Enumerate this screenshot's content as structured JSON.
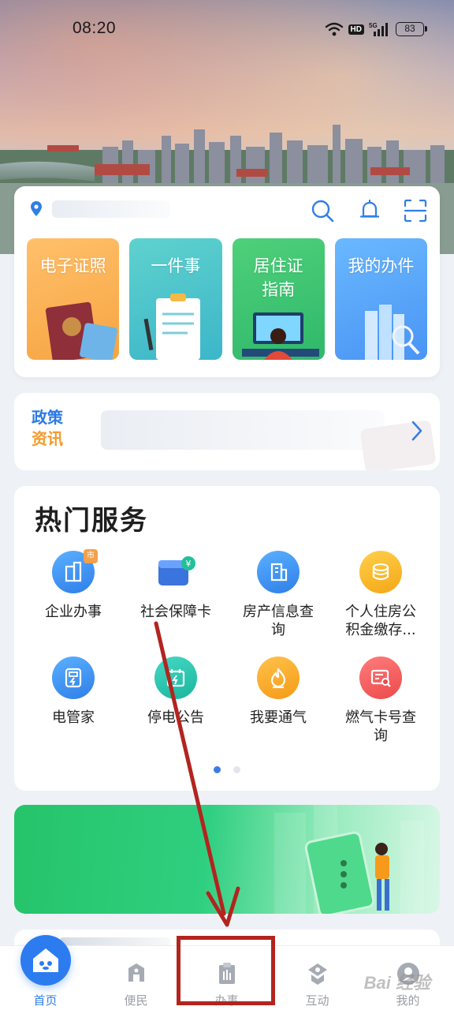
{
  "status_bar": {
    "time": "08:20",
    "hd": "HD",
    "network": "5G",
    "battery": "83"
  },
  "top_card": {
    "tiles": [
      {
        "label": "电子证照"
      },
      {
        "label": "一件事"
      },
      {
        "label": "居住证\n指南"
      },
      {
        "label": "我的办件"
      }
    ]
  },
  "policy": {
    "title_line1": "政策",
    "title_line2": "资讯"
  },
  "hot_services": {
    "title": "热门服务",
    "items": [
      {
        "label": "企业办事",
        "badge": "市",
        "icon": "building-icon"
      },
      {
        "label": "社会保障卡",
        "badge": "¥",
        "icon": "wallet-icon"
      },
      {
        "label": "房产信息查\n询",
        "icon": "house-info-icon"
      },
      {
        "label": "个人住房公\n积金缴存...",
        "icon": "coins-icon"
      },
      {
        "label": "电管家",
        "icon": "meter-icon"
      },
      {
        "label": "停电公告",
        "icon": "calendar-bolt-icon"
      },
      {
        "label": "我要通气",
        "icon": "flame-icon"
      },
      {
        "label": "燃气卡号查\n询",
        "icon": "card-search-icon"
      }
    ],
    "page_count": 2,
    "active_page": 1
  },
  "tabbar": {
    "tabs": [
      {
        "label": "首页",
        "icon": "home-icon",
        "active": true
      },
      {
        "label": "便民",
        "icon": "convenience-icon"
      },
      {
        "label": "办事",
        "icon": "affairs-icon"
      },
      {
        "label": "互动",
        "icon": "interact-icon"
      },
      {
        "label": "我的",
        "icon": "profile-icon"
      }
    ]
  },
  "watermark": "Bai 经验",
  "colors": {
    "primary_blue": "#2f7ee8",
    "annotation_red": "#b3241f"
  }
}
